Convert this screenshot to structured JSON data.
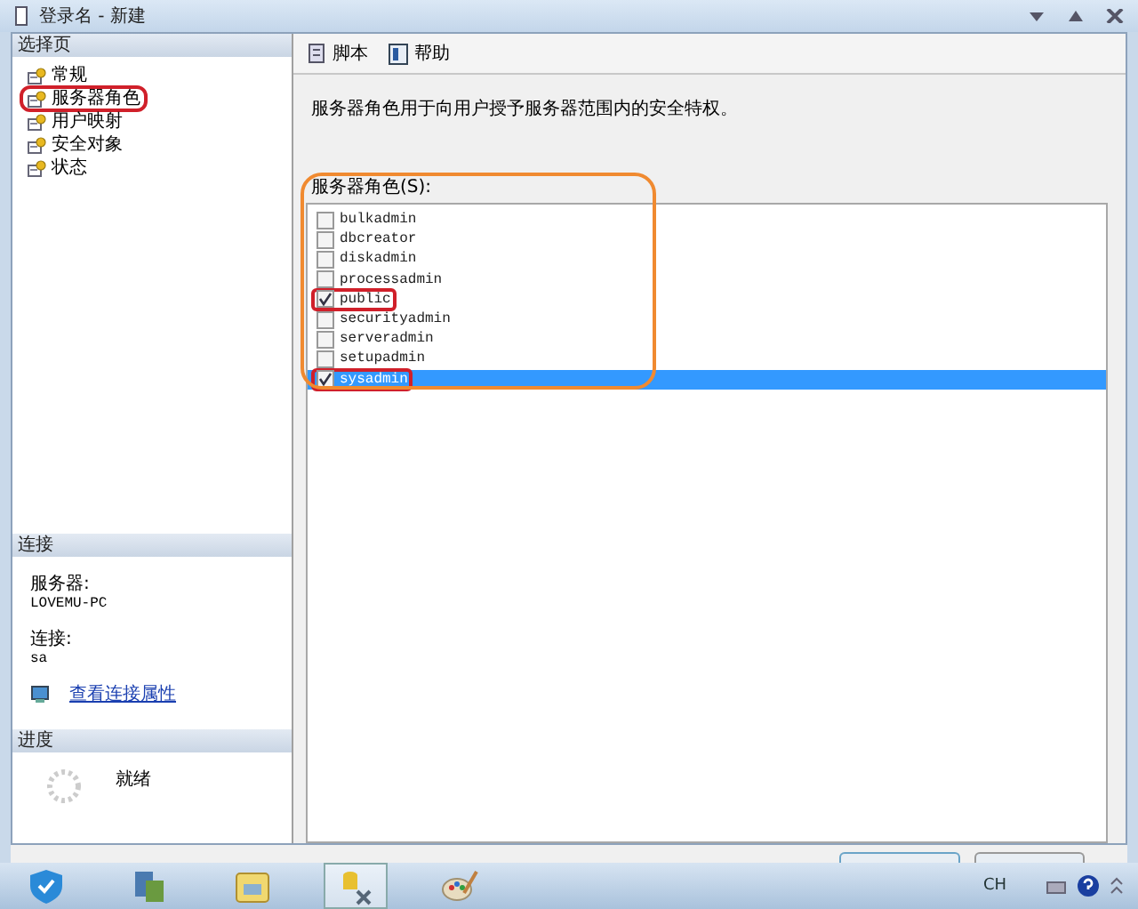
{
  "window": {
    "title": "登录名 - 新建"
  },
  "sidebar": {
    "header": "选择页",
    "items": [
      {
        "label": "常规",
        "circled": false
      },
      {
        "label": "服务器角色",
        "circled": true
      },
      {
        "label": "用户映射",
        "circled": false
      },
      {
        "label": "安全对象",
        "circled": false
      },
      {
        "label": "状态",
        "circled": false
      }
    ]
  },
  "connection": {
    "header": "连接",
    "server_label": "服务器:",
    "server": "LOVEMU-PC",
    "connection_label": "连接:",
    "connection": "sa",
    "link": "查看连接属性"
  },
  "progress": {
    "header": "进度",
    "status": "就绪"
  },
  "toolbar": [
    {
      "kind": "script",
      "label": "脚本"
    },
    {
      "kind": "help",
      "label": "帮助"
    }
  ],
  "description": "服务器角色用于向用户授予服务器范围内的安全特权。",
  "roles_label": "服务器角色(S):",
  "roles": [
    {
      "name": "bulkadmin",
      "checked": false,
      "selected": false,
      "circled": false
    },
    {
      "name": "dbcreator",
      "checked": false,
      "selected": false,
      "circled": false
    },
    {
      "name": "diskadmin",
      "checked": false,
      "selected": false,
      "circled": false
    },
    {
      "name": "processadmin",
      "checked": false,
      "selected": false,
      "circled": false
    },
    {
      "name": "public",
      "checked": true,
      "selected": false,
      "circled": true
    },
    {
      "name": "securityadmin",
      "checked": false,
      "selected": false,
      "circled": false
    },
    {
      "name": "serveradmin",
      "checked": false,
      "selected": false,
      "circled": false
    },
    {
      "name": "setupadmin",
      "checked": false,
      "selected": false,
      "circled": false
    },
    {
      "name": "sysadmin",
      "checked": true,
      "selected": true,
      "circled": true
    }
  ],
  "taskbar": {
    "input_indicator": "CH"
  }
}
